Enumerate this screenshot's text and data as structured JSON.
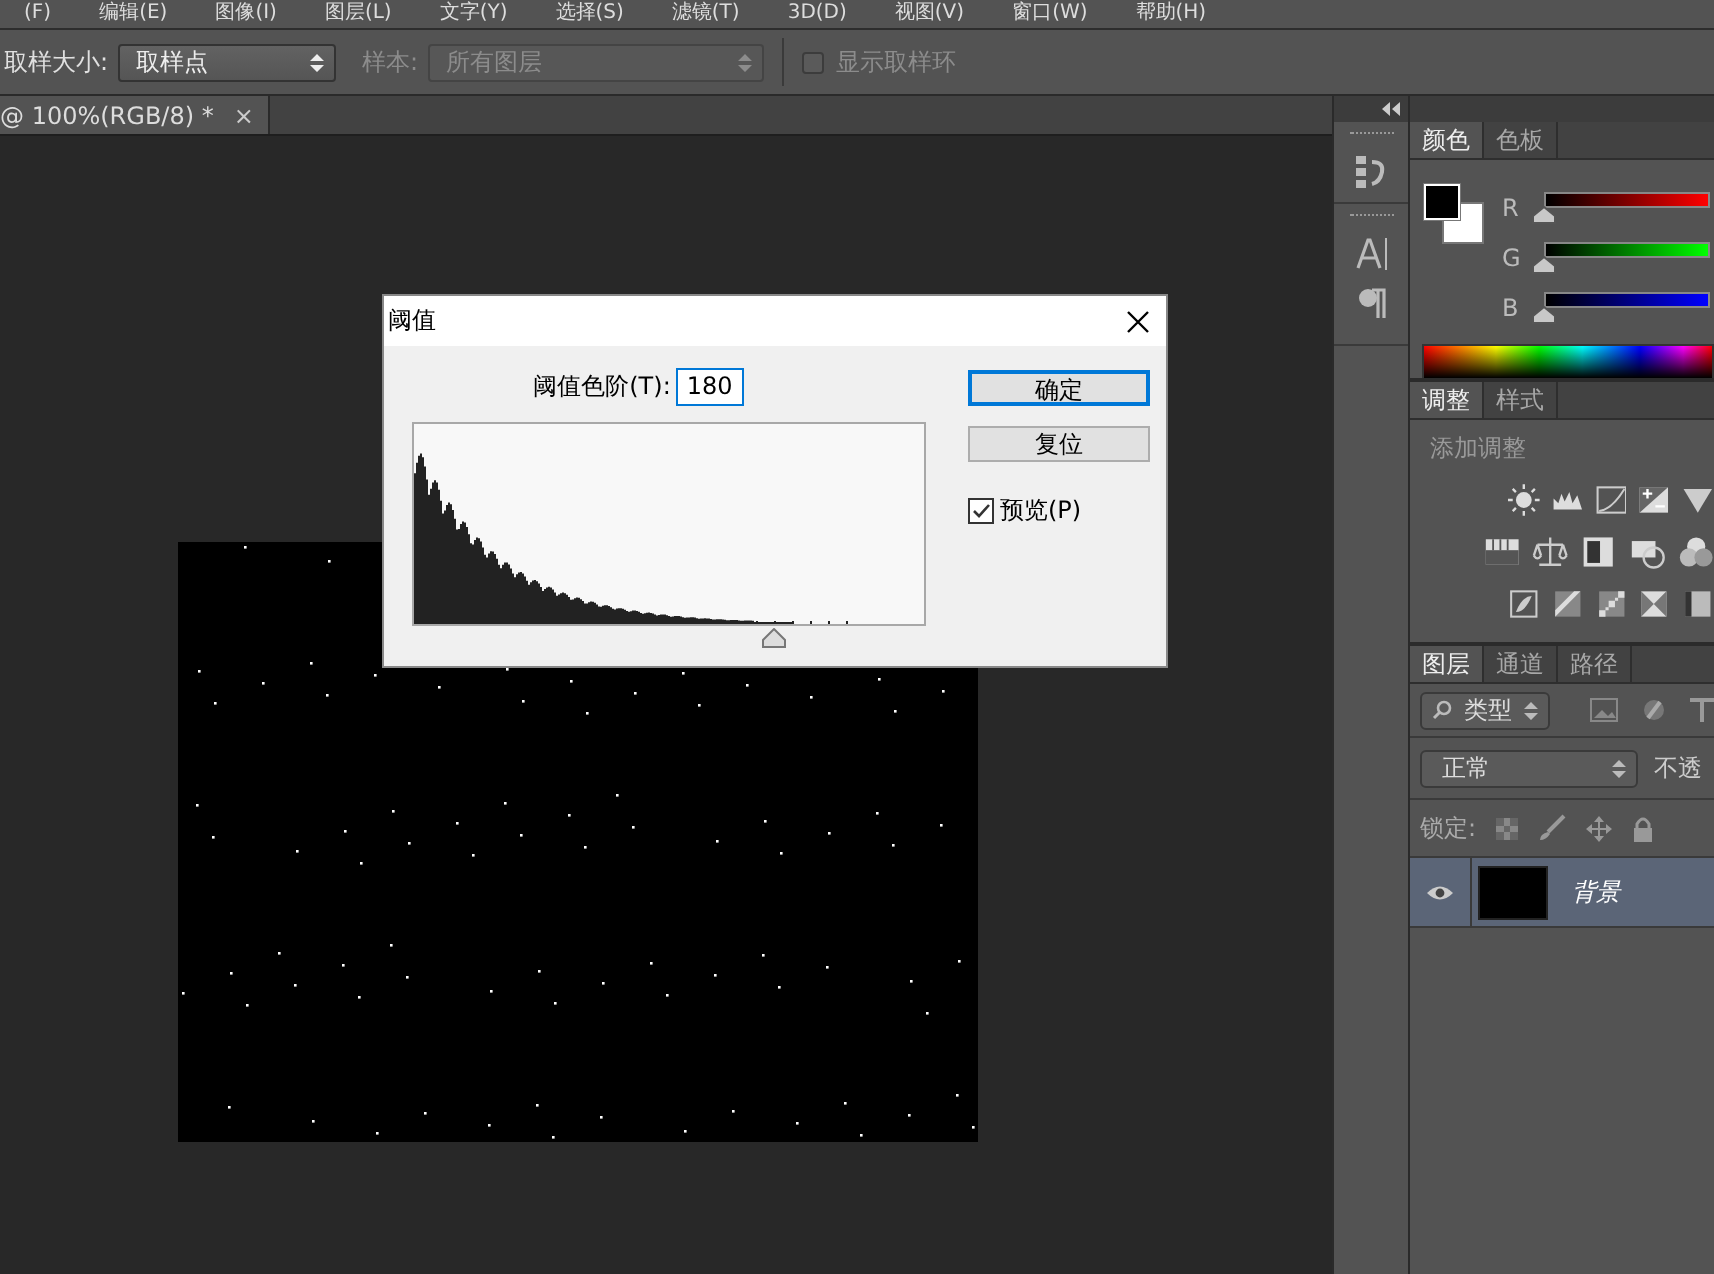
{
  "menu": [
    {
      "label": "(F)"
    },
    {
      "label": "编辑(E)"
    },
    {
      "label": "图像(I)"
    },
    {
      "label": "图层(L)"
    },
    {
      "label": "文字(Y)"
    },
    {
      "label": "选择(S)"
    },
    {
      "label": "滤镜(T)"
    },
    {
      "label": "3D(D)"
    },
    {
      "label": "视图(V)"
    },
    {
      "label": "窗口(W)"
    },
    {
      "label": "帮助(H)"
    }
  ],
  "options": {
    "sample_size": {
      "label": "取样大小:",
      "value": "取样点",
      "disabled": false
    },
    "sample": {
      "label": "样本:",
      "value": "所有图层",
      "disabled": true
    },
    "show_ring": {
      "label": "显示取样环",
      "checked": false,
      "disabled": true
    }
  },
  "document": {
    "tab": "@ 100%(RGB/8) *",
    "close": "×"
  },
  "dialog": {
    "title": "阈值",
    "threshold_label": "阈值色阶(T):",
    "threshold_value": "180",
    "slider": {
      "level": 0.706
    },
    "buttons": [
      {
        "label": "确定",
        "default": true
      },
      {
        "label": "复位",
        "default": false
      }
    ],
    "preview": {
      "label": "预览(P)",
      "checked": true
    }
  },
  "panels": {
    "color": {
      "tabs": [
        {
          "label": "颜色",
          "selected": true
        },
        {
          "label": "色板",
          "selected": false
        }
      ],
      "sliders": [
        {
          "channel": "R",
          "kind": "red",
          "level": 0
        },
        {
          "channel": "G",
          "kind": "green",
          "level": 0
        },
        {
          "channel": "B",
          "kind": "blue",
          "level": 0
        }
      ]
    },
    "adjustments": {
      "tabs": [
        {
          "label": "调整",
          "selected": true
        },
        {
          "label": "样式",
          "selected": false
        }
      ],
      "title": "添加调整"
    },
    "layers": {
      "tabs": [
        {
          "label": "图层",
          "selected": true
        },
        {
          "label": "通道",
          "selected": false
        },
        {
          "label": "路径",
          "selected": false
        }
      ],
      "filter": "类型",
      "blend_mode": "正常",
      "opacity_label": "不透",
      "lock_label": "锁定:",
      "items": [
        {
          "name": "背景",
          "selected": true,
          "visible": true
        }
      ]
    }
  }
}
